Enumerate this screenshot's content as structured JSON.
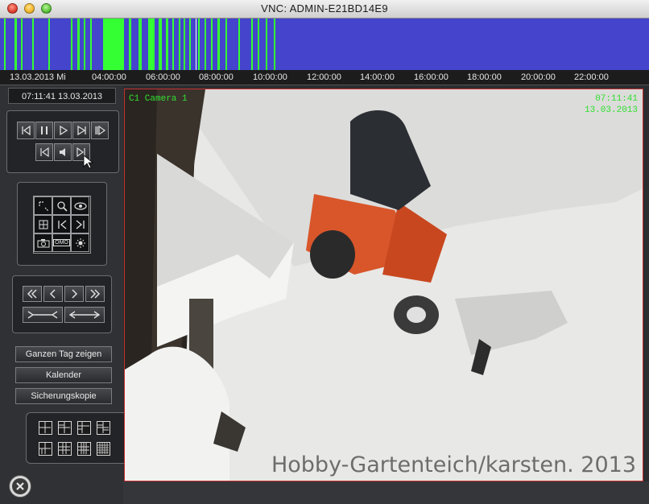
{
  "window": {
    "title": "VNC: ADMIN-E21BD14E9"
  },
  "timeline": {
    "date_label": "13.03.2013 Mi",
    "ticks": [
      "04:00:00",
      "06:00:00",
      "08:00:00",
      "10:00:00",
      "12:00:00",
      "14:00:00",
      "16:00:00",
      "18:00:00",
      "20:00:00",
      "22:00:00"
    ],
    "colors": {
      "background": "#4444cc",
      "activity": "#33ff33"
    }
  },
  "sidebar": {
    "clock": "07:11:41 13.03.2013",
    "playback_icons": [
      "step-back-icon",
      "pause-icon",
      "play-icon",
      "fast-play-icon",
      "step-forward-icon"
    ],
    "audio_icons": [
      "skip-start-icon",
      "speaker-icon",
      "skip-end-icon"
    ],
    "tool_icons": [
      "select-icon",
      "zoom-icon",
      "eye-icon",
      "grid-icon",
      "mark-in-icon",
      "mark-out-icon",
      "camera-icon",
      "omo-icon",
      "brightness-icon"
    ],
    "tool_omo_label": "OMO",
    "nav_icons": [
      "double-left-icon",
      "left-icon",
      "right-icon",
      "double-right-icon",
      "collapse-range-icon",
      "expand-range-icon"
    ],
    "buttons": {
      "whole_day": "Ganzen Tag zeigen",
      "calendar": "Kalender",
      "backup": "Sicherungskopie"
    },
    "layouts": [
      "layout-1x1-icon",
      "layout-2x2-icon",
      "layout-3x3-icon",
      "layout-4x4-icon",
      "layout-1-5-icon",
      "layout-1-7-icon",
      "layout-3x4-icon",
      "layout-5x5-icon"
    ]
  },
  "camera": {
    "name": "C1 Camera 1",
    "time": "07:11:41",
    "date": "13.03.2013",
    "watermark": "Hobby-Gartenteich/karsten. 2013"
  }
}
